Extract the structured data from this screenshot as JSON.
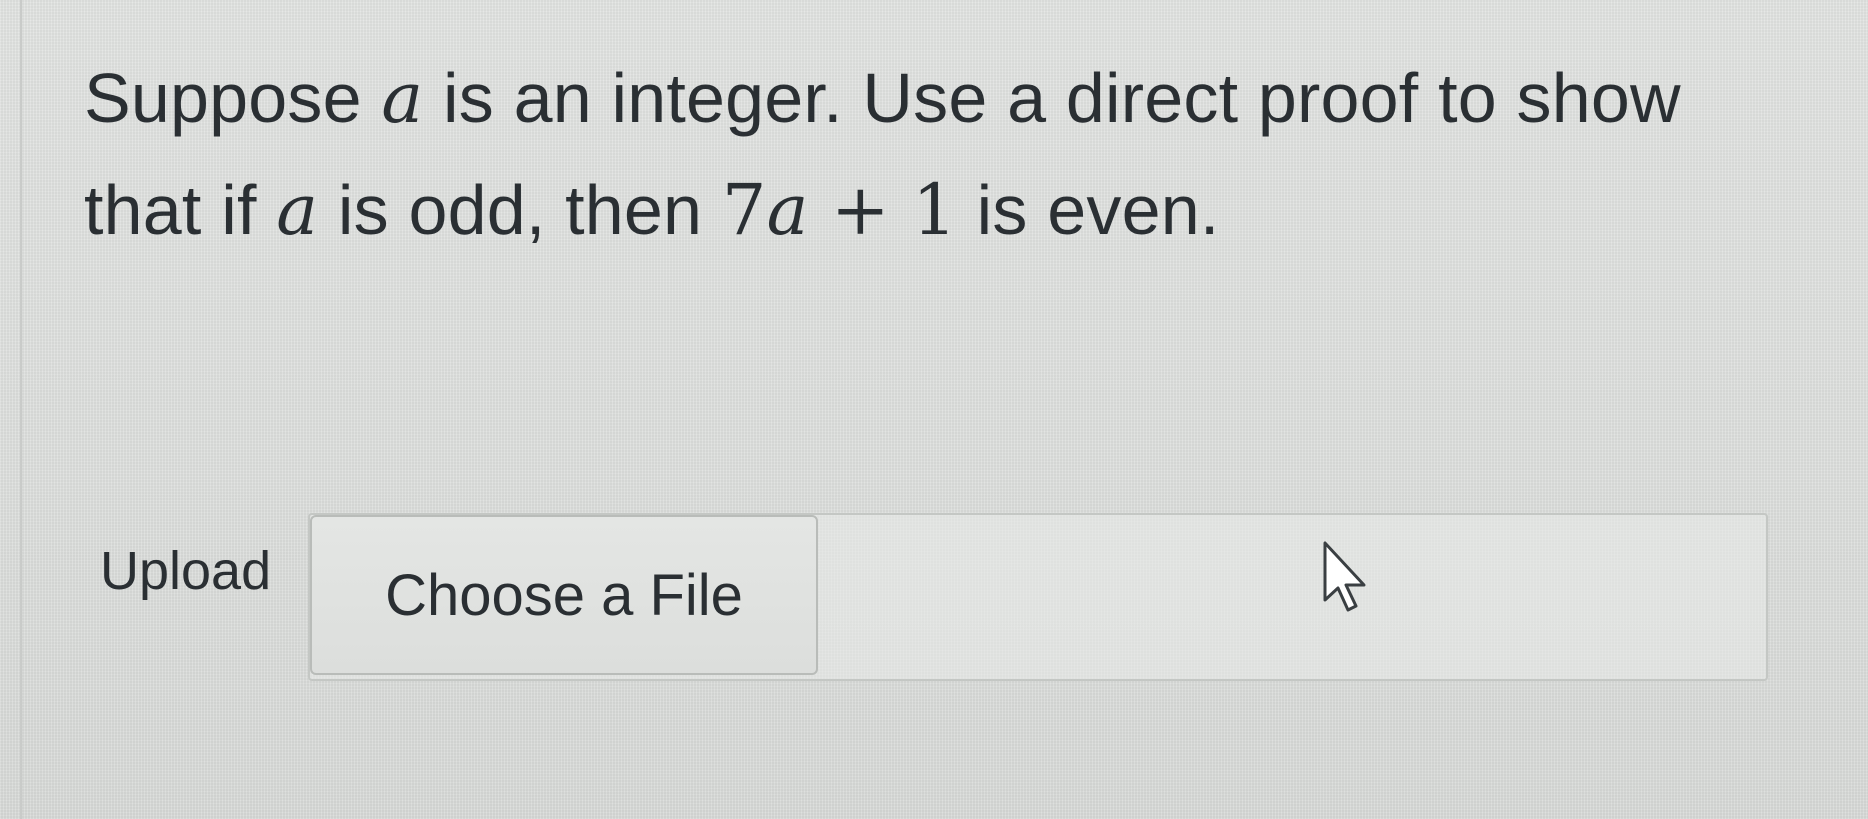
{
  "question": {
    "line1_prefix": "Suppose ",
    "var_a_1": "a",
    "line1_suffix": " is an integer. Use a direct proof to show",
    "line2_prefix": "that if ",
    "var_a_2": "a",
    "line2_middle": " is odd, then ",
    "expr_seven": "7",
    "var_a_3": "a",
    "expr_plus_one": " + 1",
    "line2_suffix": " is even."
  },
  "upload": {
    "label": "Upload",
    "button_label": "Choose a File",
    "file_name": ""
  },
  "cursor": {
    "icon": "mouse-pointer-icon"
  },
  "colors": {
    "background": "#dfe1df",
    "text": "#2a2f33",
    "border": "#c4c7c4"
  }
}
